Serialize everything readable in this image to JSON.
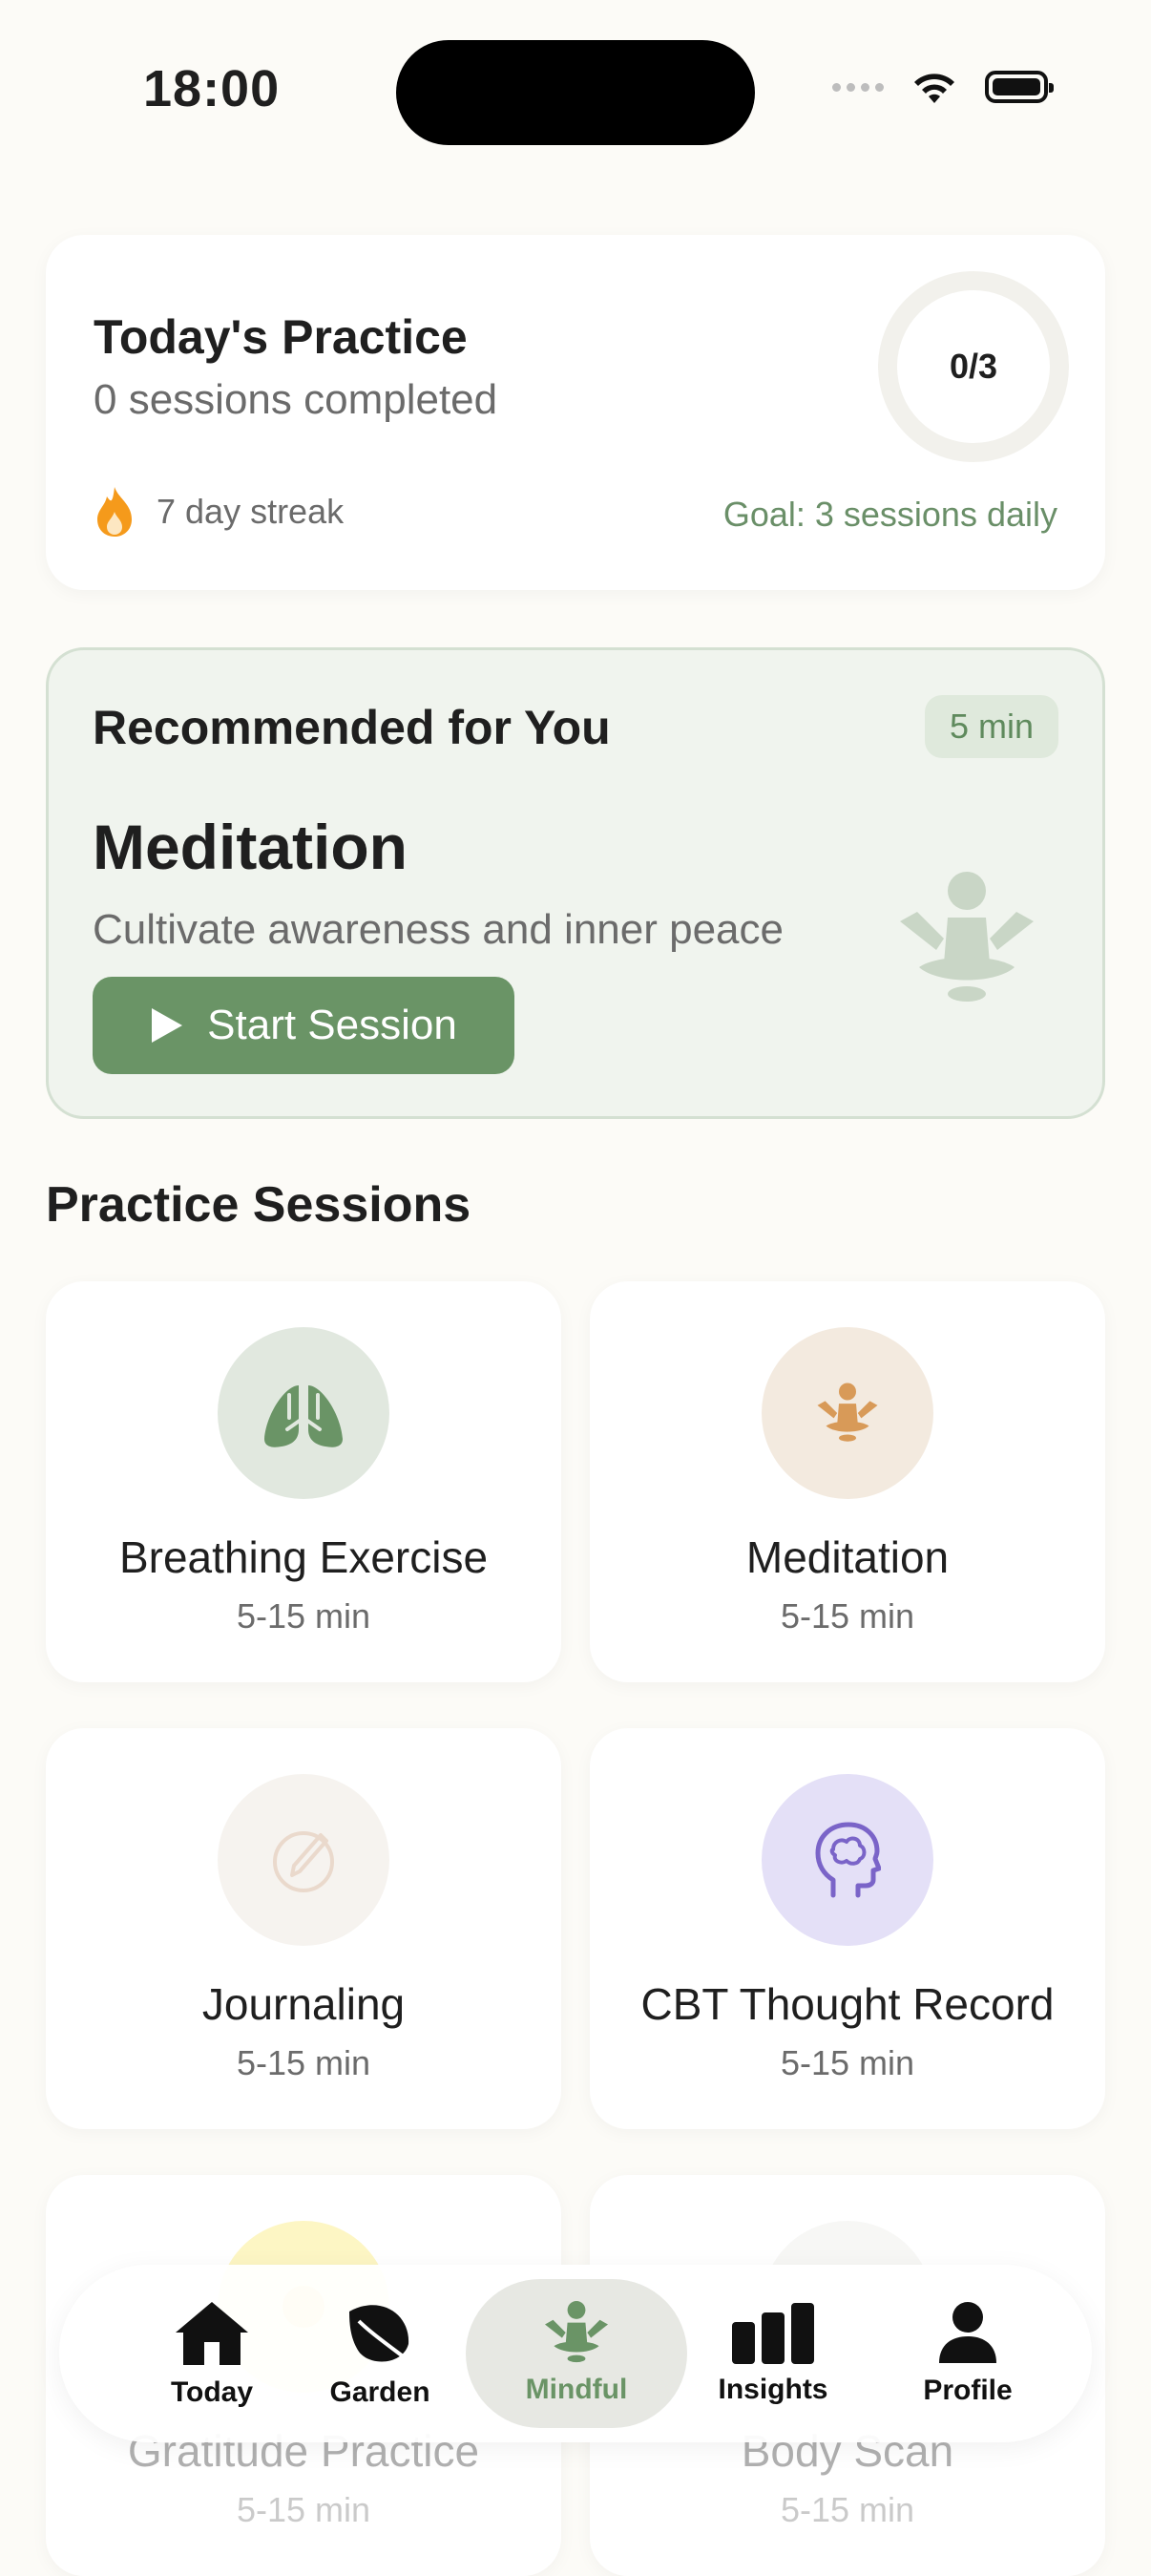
{
  "status": {
    "time": "18:00"
  },
  "today": {
    "title": "Today's Practice",
    "subtitle": "0 sessions completed",
    "progress_text": "0/3",
    "progress": 0,
    "streak": "7 day streak",
    "goal": "Goal: 3 sessions daily"
  },
  "recommended": {
    "header": "Recommended for You",
    "badge": "5 min",
    "title": "Meditation",
    "description": "Cultivate awareness and inner peace",
    "button": "Start Session"
  },
  "sessions": {
    "title": "Practice Sessions",
    "items": [
      {
        "name": "Breathing Exercise",
        "duration": "5-15 min",
        "icon": "lungs-icon",
        "color": "#e1e8df"
      },
      {
        "name": "Meditation",
        "duration": "5-15 min",
        "icon": "meditation-icon",
        "color": "#f3eadf"
      },
      {
        "name": "Journaling",
        "duration": "5-15 min",
        "icon": "pencil-icon",
        "color": "#f6f3ef"
      },
      {
        "name": "CBT Thought Record",
        "duration": "5-15 min",
        "icon": "brain-icon",
        "color": "#e4e0f7"
      },
      {
        "name": "Gratitude Practice",
        "duration": "5-15 min",
        "icon": "sun-icon",
        "color": "#fdf6c4"
      },
      {
        "name": "Body Scan",
        "duration": "5-15 min",
        "icon": "body-icon",
        "color": "#f1f1f1"
      }
    ]
  },
  "nav": {
    "items": [
      {
        "label": "Today",
        "icon": "home-icon"
      },
      {
        "label": "Garden",
        "icon": "leaf-icon"
      },
      {
        "label": "Mindful",
        "icon": "meditation-icon"
      },
      {
        "label": "Insights",
        "icon": "bar-chart-icon"
      },
      {
        "label": "Profile",
        "icon": "person-icon"
      }
    ]
  },
  "colors": {
    "accent": "#6a9466",
    "background": "#fcfbf7"
  }
}
